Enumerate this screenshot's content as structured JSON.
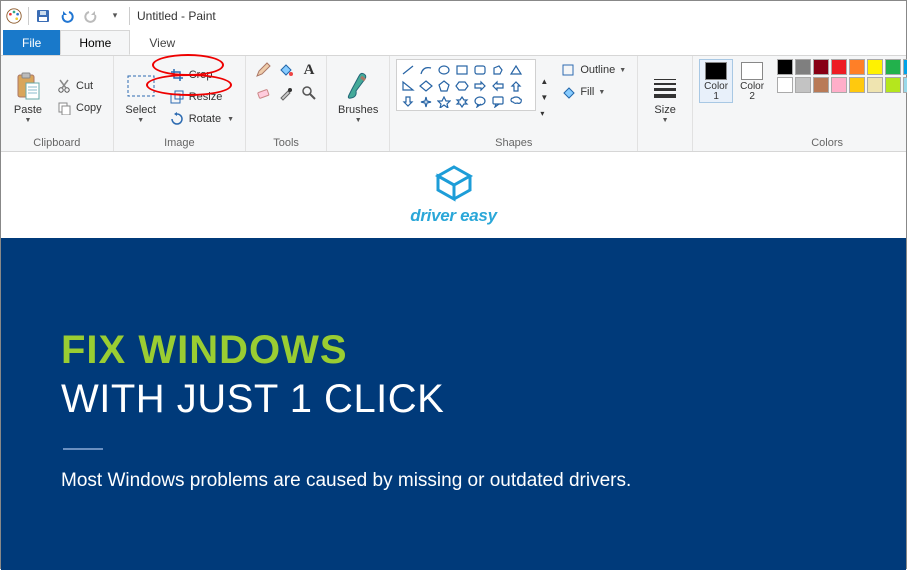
{
  "title": "Untitled - Paint",
  "tabs": {
    "file": "File",
    "home": "Home",
    "view": "View"
  },
  "groups": {
    "clipboard": {
      "label": "Clipboard",
      "paste": "Paste",
      "cut": "Cut",
      "copy": "Copy"
    },
    "image": {
      "label": "Image",
      "select": "Select",
      "crop": "Crop",
      "resize": "Resize",
      "rotate": "Rotate"
    },
    "tools": {
      "label": "Tools"
    },
    "brushes": {
      "label": "Brushes"
    },
    "shapes": {
      "label": "Shapes",
      "outline": "Outline",
      "fill": "Fill"
    },
    "size": {
      "label": "Size"
    },
    "colors": {
      "label": "Colors",
      "color1": "Color\n1",
      "color2": "Color\n2"
    }
  },
  "palette_row1": [
    "#000000",
    "#7f7f7f",
    "#880015",
    "#ed1c24",
    "#ff7f27",
    "#fff200",
    "#22b14c",
    "#00a2e8",
    "#3f48cc",
    "#a349a4"
  ],
  "palette_row2": [
    "#ffffff",
    "#c3c3c3",
    "#b97a57",
    "#ffaec9",
    "#ffc90e",
    "#efe4b0",
    "#b5e61d",
    "#99d9ea",
    "#7092be",
    "#c8bfe7"
  ],
  "color1_value": "#000000",
  "color2_value": "#ffffff",
  "doc": {
    "logo_text": "driver easy",
    "heading_green": "FIX WINDOWS",
    "heading_white": "WITH JUST 1 CLICK",
    "para1": "Most Windows problems are caused by missing or outdated drivers."
  }
}
